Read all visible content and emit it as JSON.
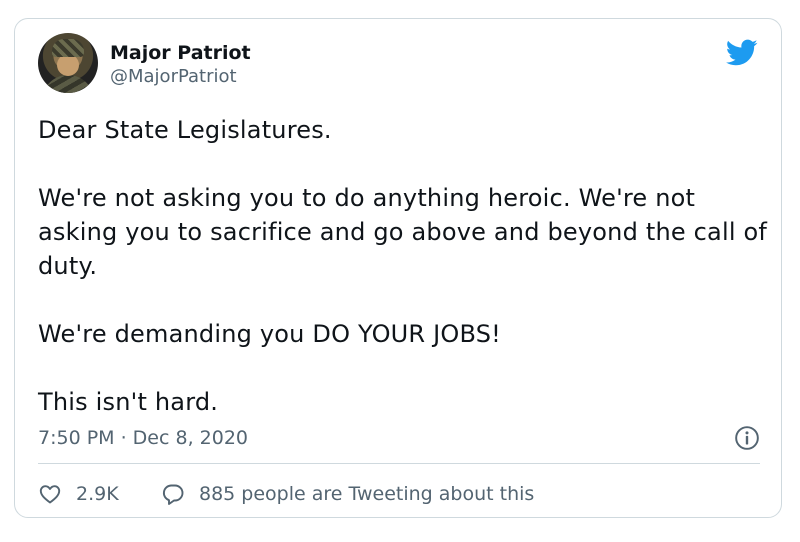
{
  "author": {
    "name": "Major Patriot",
    "handle": "@MajorPatriot"
  },
  "tweet": {
    "text": "Dear State Legislatures.\n\nWe're not asking you to do anything heroic.  We're not asking you to sacrifice and go above and beyond the call of duty.\n\nWe're demanding you DO YOUR JOBS!\n\nThis isn't hard.",
    "timestamp": "7:50 PM · Dec 8, 2020"
  },
  "actions": {
    "likes": "2.9K",
    "tweeting": "885 people are Tweeting about this"
  },
  "icons": {
    "logo": "twitter-bird-icon",
    "info": "info-icon",
    "like": "heart-icon",
    "reply": "speech-bubble-icon"
  },
  "colors": {
    "brand": "#1d9bf0",
    "secondary_text": "#536471",
    "border": "#cfd9de"
  }
}
